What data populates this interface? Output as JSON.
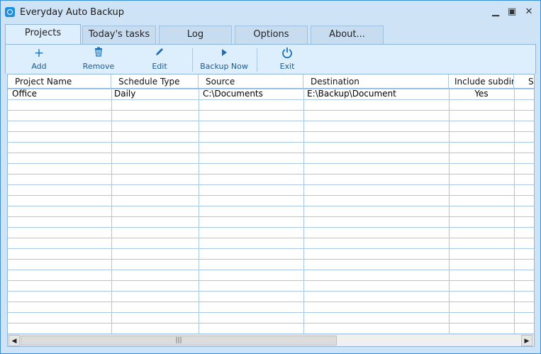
{
  "window": {
    "title": "Everyday Auto Backup",
    "controls": {
      "minimize": "▁",
      "maximize": "▣",
      "close": "✕"
    }
  },
  "tabs": [
    {
      "label": "Projects",
      "active": true
    },
    {
      "label": "Today's tasks",
      "active": false
    },
    {
      "label": "Log",
      "active": false
    },
    {
      "label": "Options",
      "active": false
    },
    {
      "label": "About...",
      "active": false
    }
  ],
  "toolbar": {
    "add": {
      "label": "Add",
      "icon": "plus-icon",
      "glyph": "+"
    },
    "remove": {
      "label": "Remove",
      "icon": "trash-icon",
      "glyph": "🗑"
    },
    "edit": {
      "label": "Edit",
      "icon": "pencil-icon",
      "glyph": "✎"
    },
    "backup_now": {
      "label": "Backup Now",
      "icon": "play-icon",
      "glyph": "▶"
    },
    "exit": {
      "label": "Exit",
      "icon": "power-icon",
      "glyph": "⏻"
    }
  },
  "table": {
    "columns": [
      "Project Name",
      "Schedule Type",
      "Source",
      "Destination",
      "Include subdir",
      "S"
    ],
    "rows": [
      {
        "project_name": "Office",
        "schedule_type": "Daily",
        "source": "C:\\Documents",
        "destination": "E:\\Backup\\Document",
        "include_subdir": "Yes"
      }
    ]
  },
  "scrollbar": {
    "left": "◀",
    "right": "▶",
    "grip": "|||"
  },
  "colors": {
    "frame": "#3c8fd6",
    "chrome": "#cfe3f6",
    "accent": "#1a6fb8",
    "grid": "#a9c8e4"
  }
}
